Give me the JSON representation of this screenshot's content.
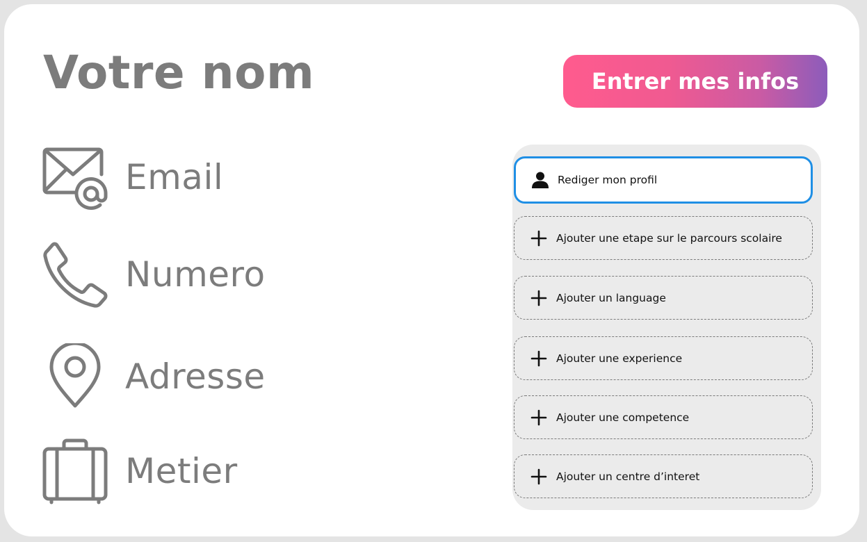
{
  "profile": {
    "name": "Votre nom",
    "fields": [
      {
        "icon": "email-icon",
        "label": "Email"
      },
      {
        "icon": "phone-icon",
        "label": "Numero"
      },
      {
        "icon": "location-pin-icon",
        "label": "Adresse"
      },
      {
        "icon": "briefcase-icon",
        "label": "Metier"
      }
    ]
  },
  "actions": {
    "enter_info_label": "Entrer mes infos"
  },
  "panel": {
    "items": [
      {
        "icon": "user-icon",
        "label": "Rediger mon profil",
        "active": true
      },
      {
        "icon": "plus-icon",
        "label": "Ajouter une etape sur le parcours scolaire",
        "active": false
      },
      {
        "icon": "plus-icon",
        "label": "Ajouter un language",
        "active": false
      },
      {
        "icon": "plus-icon",
        "label": "Ajouter une experience",
        "active": false
      },
      {
        "icon": "plus-icon",
        "label": "Ajouter une competence",
        "active": false
      },
      {
        "icon": "plus-icon",
        "label": "Ajouter un centre d’interet",
        "active": false
      }
    ]
  },
  "colors": {
    "text_gray": "#7c7c7c",
    "accent_blue": "#1f8fe5",
    "gradient_start": "#ff5b8e",
    "gradient_end": "#8c5cbb",
    "panel_bg": "#ebebeb"
  }
}
